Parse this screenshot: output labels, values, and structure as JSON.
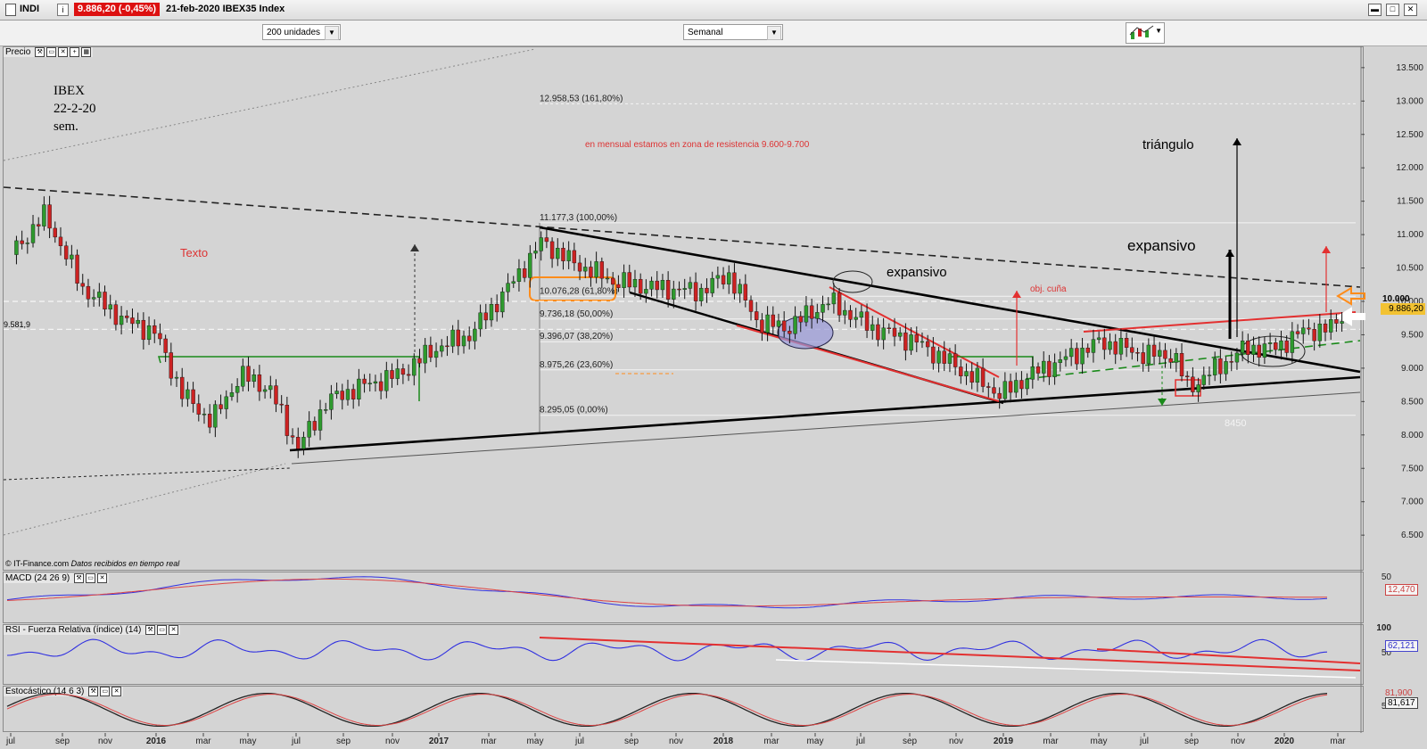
{
  "titlebar": {
    "menu_icon": "menu-icon",
    "ticker": "INDI",
    "price": "9.886,20 (-0,45%)",
    "info": "21-feb-2020 IBEX35 Index"
  },
  "toolbar": {
    "units_select": "200 unidades",
    "period_select": "Semanal",
    "chart_style_icon": "chart-style-icon"
  },
  "panels": {
    "price": {
      "label": "Precio"
    },
    "macd": {
      "label": "MACD (24 26 9)",
      "value": "12,470"
    },
    "rsi": {
      "label": "RSI - Fuerza Relativa (índice) (14)",
      "value": "62,121"
    },
    "stoch": {
      "label": "Estocástico (14 6 3)",
      "value1": "81,900",
      "value2": "81,617"
    }
  },
  "annotations": {
    "header": [
      "IBEX",
      "22-2-20",
      "sem."
    ],
    "texto": "Texto",
    "resistencia": "en mensual estamos en zona de resistencia 9.600-9.700",
    "triangulo": "triángulo",
    "expansivo_big": "expansivo",
    "expansivo_small": "expansivo",
    "obj_cuna": "obj. cuña",
    "level_8450": "8450",
    "left_level": "9.581,9",
    "copyright": "© IT-Finance.com",
    "datos": "Datos recibidos en tiempo real",
    "current_price_tag": "9.886,20",
    "round_level_tag": "10.000"
  },
  "chart_data": {
    "type": "candlestick",
    "title": "IBEX35 Index",
    "frequency": "Semanal",
    "price_axis": {
      "ylim": [
        6000,
        13700
      ],
      "ticks": [
        "6.500",
        "7.000",
        "7.500",
        "8.000",
        "8.500",
        "9.000",
        "9.500",
        "10.000",
        "10.500",
        "11.000",
        "11.500",
        "12.000",
        "12.500",
        "13.000",
        "13.500"
      ]
    },
    "time_axis": [
      "jul",
      "sep",
      "nov",
      "2016",
      "mar",
      "may",
      "jul",
      "sep",
      "nov",
      "2017",
      "mar",
      "may",
      "jul",
      "sep",
      "nov",
      "2018",
      "mar",
      "may",
      "jul",
      "sep",
      "nov",
      "2019",
      "mar",
      "may",
      "jul",
      "sep",
      "nov",
      "2020",
      "mar"
    ],
    "fibonacci": [
      {
        "label": "12.958,53 (161,80%)",
        "value": 12958.53
      },
      {
        "label": "11.177,3 (100,00%)",
        "value": 11177.3
      },
      {
        "label": "10.076,28 (61,80%)",
        "value": 10076.28
      },
      {
        "label": "9.736,18 (50,00%)",
        "value": 9736.18
      },
      {
        "label": "9.396,07 (38,20%)",
        "value": 9396.07
      },
      {
        "label": "8.975,26 (23,60%)",
        "value": 8975.26
      },
      {
        "label": "8.295,05 (0,00%)",
        "value": 8295.05
      }
    ],
    "close_path": [
      [
        2015.5,
        10700
      ],
      [
        2015.62,
        11300
      ],
      [
        2015.75,
        10200
      ],
      [
        2015.9,
        9700
      ],
      [
        2016.0,
        9550
      ],
      [
        2016.1,
        8600
      ],
      [
        2016.2,
        8200
      ],
      [
        2016.3,
        8900
      ],
      [
        2016.4,
        8700
      ],
      [
        2016.5,
        7800
      ],
      [
        2016.6,
        8500
      ],
      [
        2016.7,
        8700
      ],
      [
        2016.85,
        8900
      ],
      [
        2016.98,
        9300
      ],
      [
        2017.1,
        9500
      ],
      [
        2017.25,
        10300
      ],
      [
        2017.35,
        10900
      ],
      [
        2017.45,
        10600
      ],
      [
        2017.6,
        10300
      ],
      [
        2017.75,
        10200
      ],
      [
        2017.9,
        10150
      ],
      [
        2018.0,
        10400
      ],
      [
        2018.1,
        9700
      ],
      [
        2018.2,
        9600
      ],
      [
        2018.35,
        10000
      ],
      [
        2018.5,
        9600
      ],
      [
        2018.65,
        9400
      ],
      [
        2018.8,
        9000
      ],
      [
        2018.95,
        8600
      ],
      [
        2019.05,
        8900
      ],
      [
        2019.2,
        9200
      ],
      [
        2019.3,
        9400
      ],
      [
        2019.45,
        9200
      ],
      [
        2019.55,
        9200
      ],
      [
        2019.6,
        8700
      ],
      [
        2019.7,
        9000
      ],
      [
        2019.8,
        9300
      ],
      [
        2019.9,
        9300
      ],
      [
        2020.0,
        9550
      ],
      [
        2020.1,
        9600
      ],
      [
        2020.15,
        9886
      ]
    ],
    "macd": {
      "ylim": [
        -120,
        100
      ],
      "value": 12.47,
      "ticks": [
        "50"
      ]
    },
    "rsi": {
      "ylim": [
        0,
        100
      ],
      "value": 62.121,
      "ticks": [
        "100",
        "50"
      ]
    },
    "stochastic": {
      "ylim": [
        0,
        100
      ],
      "values": [
        81.9,
        81.617
      ],
      "ticks": [
        "50"
      ]
    }
  },
  "colors": {
    "bull": "#2e9a2e",
    "bear": "#cc2222",
    "trend": "#000000",
    "red_line": "#e33030",
    "orange": "#ff8c1a",
    "blue": "#3030e0"
  }
}
